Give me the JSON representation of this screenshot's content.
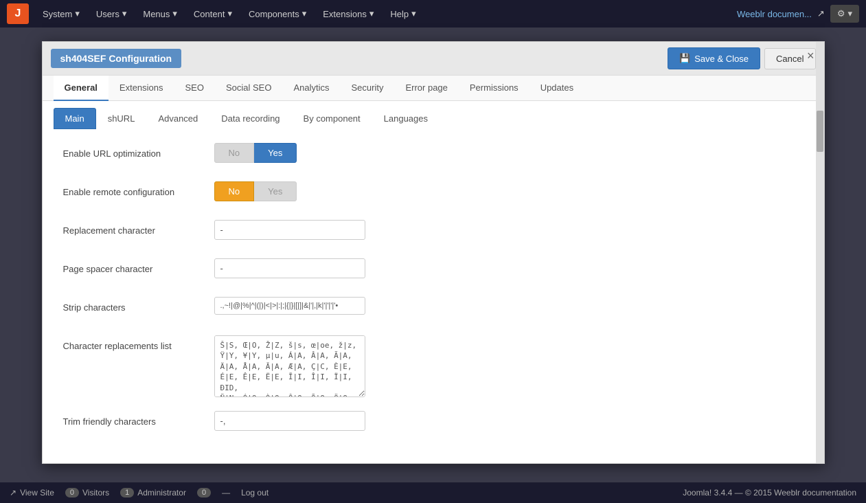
{
  "navbar": {
    "brand": "J",
    "items": [
      {
        "label": "System",
        "id": "system"
      },
      {
        "label": "Users",
        "id": "users"
      },
      {
        "label": "Menus",
        "id": "menus"
      },
      {
        "label": "Content",
        "id": "content"
      },
      {
        "label": "Components",
        "id": "components"
      },
      {
        "label": "Extensions",
        "id": "extensions"
      },
      {
        "label": "Help",
        "id": "help"
      }
    ],
    "right_link": "Weeblr documen...",
    "gear": "⚙"
  },
  "modal": {
    "title": "sh404SEF Configuration",
    "save_close_label": "Save & Close",
    "cancel_label": "Cancel",
    "close_x": "×"
  },
  "tabs_row1": [
    {
      "label": "General",
      "active": true
    },
    {
      "label": "Extensions",
      "active": false
    },
    {
      "label": "SEO",
      "active": false
    },
    {
      "label": "Social SEO",
      "active": false
    },
    {
      "label": "Analytics",
      "active": false
    },
    {
      "label": "Security",
      "active": false
    },
    {
      "label": "Error page",
      "active": false
    },
    {
      "label": "Permissions",
      "active": false
    },
    {
      "label": "Updates",
      "active": false
    }
  ],
  "tabs_row2": [
    {
      "label": "Main",
      "active": true
    },
    {
      "label": "shURL",
      "active": false
    },
    {
      "label": "Advanced",
      "active": false
    },
    {
      "label": "Data recording",
      "active": false
    },
    {
      "label": "By component",
      "active": false
    },
    {
      "label": "Languages",
      "active": false
    }
  ],
  "form": {
    "fields": [
      {
        "id": "enable-url-optimization",
        "label": "Enable URL optimization",
        "type": "toggle",
        "options": [
          "No",
          "Yes"
        ],
        "active": "Yes",
        "active_style": "blue"
      },
      {
        "id": "enable-remote-configuration",
        "label": "Enable remote configuration",
        "type": "toggle",
        "options": [
          "No",
          "Yes"
        ],
        "active": "No",
        "active_style": "orange"
      },
      {
        "id": "replacement-character",
        "label": "Replacement character",
        "type": "text",
        "value": "-"
      },
      {
        "id": "page-spacer-character",
        "label": "Page spacer character",
        "type": "text",
        "value": "-"
      },
      {
        "id": "strip-characters",
        "label": "Strip characters",
        "type": "text",
        "value": ".,~!|@|%|^|(|)|<|>|:|;|{|}|[|]|&|'|,|k|'|'|'|'•"
      },
      {
        "id": "character-replacements-list",
        "label": "Character replacements list",
        "type": "textarea",
        "value": "Š|S, Œ|O, Ž|Z, š|s, œ|oe, ž|z, Ÿ|Y, ¥|Y, µ|u, Á|A, Â|A, Ã|A, Ä|A, Å|A, Ā|A, Æ|A, Ç|C, È|E, É|E, Ê|E, Ë|E, Ī|I, Î|I, Ï|I, Î|D, Ñ|N, Ó|O, Ò|O, Ô|O, Õ|O, Ö|O,"
      },
      {
        "id": "trim-friendly-characters",
        "label": "Trim friendly characters",
        "type": "text",
        "value": "-,"
      }
    ]
  },
  "statusbar": {
    "view_site": "View Site",
    "visitors_label": "Visitors",
    "visitors_count": "0",
    "administrator_label": "Administrator",
    "administrator_count": "1",
    "messages_count": "0",
    "logout_label": "Log out",
    "right_text": "Joomla! 3.4.4 — © 2015 Weeblr documentation"
  }
}
